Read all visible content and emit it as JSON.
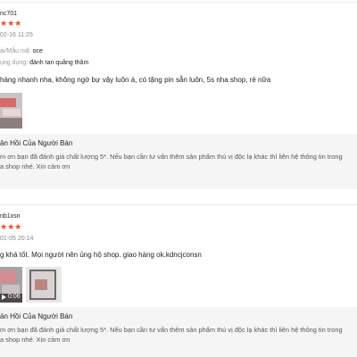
{
  "reviews": [
    {
      "username": "nc701",
      "rating": 5,
      "stars": "★★★",
      "datetime": "02-16 11:25",
      "variant_label": "ại/Mẫu mã:",
      "variant_value": "oce",
      "usage_label": "ụng dụng:",
      "usage_value": "đánh tan quầng thâm",
      "content": "hàng nhanh nha, không ngờ bự vậy luôn á, có tặng pin sẵn luôn, 5s nha shop, rẻ nữa",
      "reply_title": "ản Hồi Của Người Bán",
      "reply_text": "m ơn bạn đã đánh giá chất lượng 5*. Nếu bạn cần tư vấn thêm sản phẩm thú vị độc lạ khác thì liên hệ thông tin trong",
      "reply_text_2": "a shop nhé. Xin cảm ơn"
    },
    {
      "username": "nb1xsn",
      "rating": 5,
      "stars": "★★★",
      "datetime": "01-05 20:14",
      "content": "g khá tốt. Mọi người nên ủng hộ shop. giao hàng ok.kdncjconsn",
      "video_duration": "0:06",
      "reply_title": "ản Hồi Của Người Bán",
      "reply_text": "m ơn bạn đã đánh giá chất lượng 5*. Nếu bạn cần tư vấn thêm sản phẩm thú vị độc lạ khác thì liên hệ thông tin trong",
      "reply_text_2": "a shop nhé. Xin cảm ơn"
    }
  ],
  "colors": {
    "star": "#ee4d2d",
    "reply_bg": "#f5f5f5",
    "divider": "#eeeeee"
  },
  "icons": {
    "play": "play-icon"
  }
}
